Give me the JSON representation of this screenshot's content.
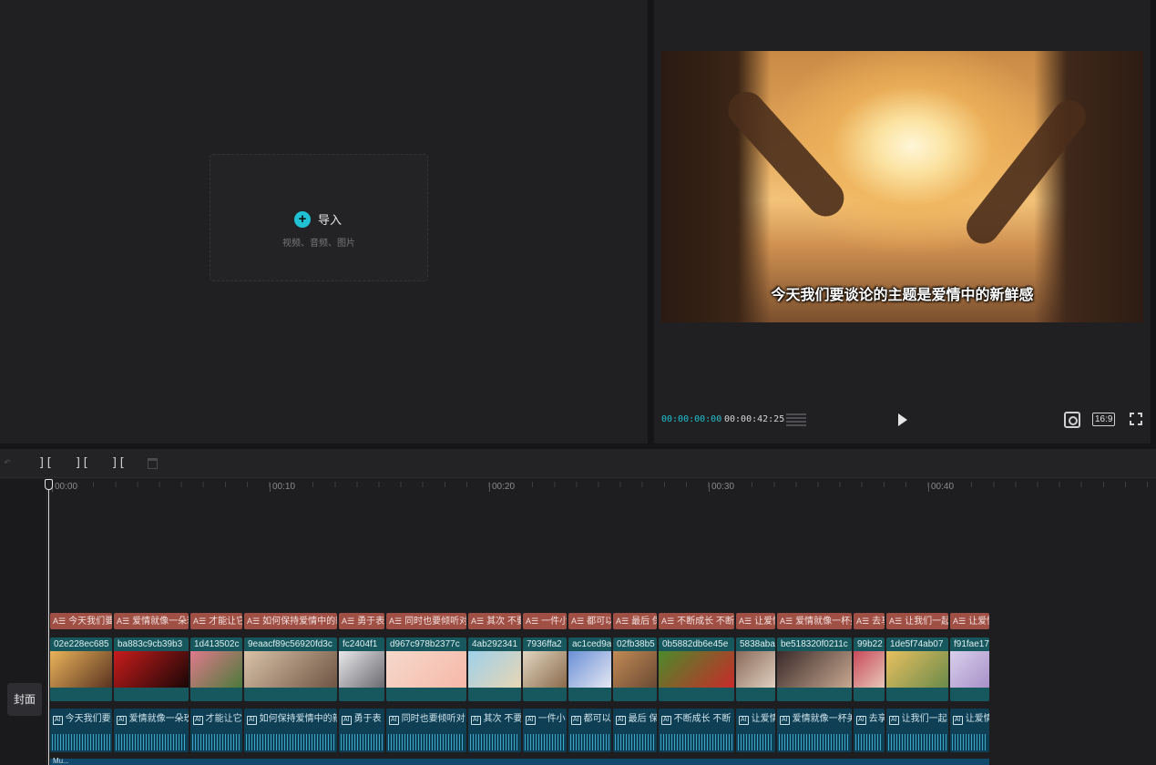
{
  "media_panel": {
    "import_label": "导入",
    "import_hint": "视频、音频、图片"
  },
  "player": {
    "subtitle": "今天我们要谈论的主题是爱情中的新鲜感",
    "current_time": "00:00:00:00",
    "separator": "/",
    "total_time": "00:00:42:25",
    "ratio_label": "16:9"
  },
  "toolbar": {
    "split_icon": "][",
    "split_left_icon": "][",
    "split_right_icon": "]["
  },
  "ruler": {
    "labels": [
      "00:00",
      "00:10",
      "00:20",
      "00:30",
      "00:40"
    ]
  },
  "side": {
    "cover_label": "封面"
  },
  "music": {
    "label": "Mu..."
  },
  "clips": [
    {
      "text": "今天我们要",
      "video": "02e228ec685",
      "colors": [
        "#e9b35a",
        "#5a3320"
      ]
    },
    {
      "text": "爱情就像一朵玫",
      "video": "ba883c9cb39b3",
      "colors": [
        "#c81c1c",
        "#1a0606"
      ]
    },
    {
      "text": "才能让它",
      "video": "1d413502c",
      "colors": [
        "#e07a8c",
        "#4c7a3a"
      ]
    },
    {
      "text": "如何保持爱情中的新",
      "video": "9eaacf89c56920fd3c",
      "colors": [
        "#d9c2a8",
        "#6e5544"
      ]
    },
    {
      "text": "勇于表",
      "video": "fc2404f1",
      "colors": [
        "#e8e8ea",
        "#6a6a70"
      ]
    },
    {
      "text": "同时也要倾听对",
      "video": "d967c978b2377c",
      "colors": [
        "#f4d9cc",
        "#f7b8a8"
      ]
    },
    {
      "text": "其次 不要",
      "video": "4ab292341",
      "colors": [
        "#9fd0ea",
        "#e7d6b4"
      ]
    },
    {
      "text": "一件小",
      "video": "7936ffa2",
      "colors": [
        "#e2d6c2",
        "#8a6a4a"
      ]
    },
    {
      "text": "都可以",
      "video": "ac1ced9a",
      "colors": [
        "#6a8fd6",
        "#e6e8f2"
      ]
    },
    {
      "text": "最后 保",
      "video": "02fb38b5",
      "colors": [
        "#c28a55",
        "#6a4a33"
      ]
    },
    {
      "text": "不断成长 不断",
      "video": "0b5882db6e45e",
      "colors": [
        "#4c8a2a",
        "#c82a2a"
      ]
    },
    {
      "text": "让爱情",
      "video": "5838aba",
      "colors": [
        "#8a6a5a",
        "#e0d0c0"
      ]
    },
    {
      "text": "爱情就像一杯美",
      "video": "be518320f0211c",
      "colors": [
        "#3a2a2a",
        "#c8a890"
      ]
    },
    {
      "text": "去享",
      "video": "99b22",
      "colors": [
        "#c84a5a",
        "#e8c8b8"
      ]
    },
    {
      "text": "让我们一起",
      "video": "1de5f74ab07",
      "colors": [
        "#e8c060",
        "#6a8a4a"
      ]
    },
    {
      "text": "让爱情",
      "video": "f91fae17",
      "colors": [
        "#d8d0ec",
        "#a890c8"
      ]
    }
  ]
}
